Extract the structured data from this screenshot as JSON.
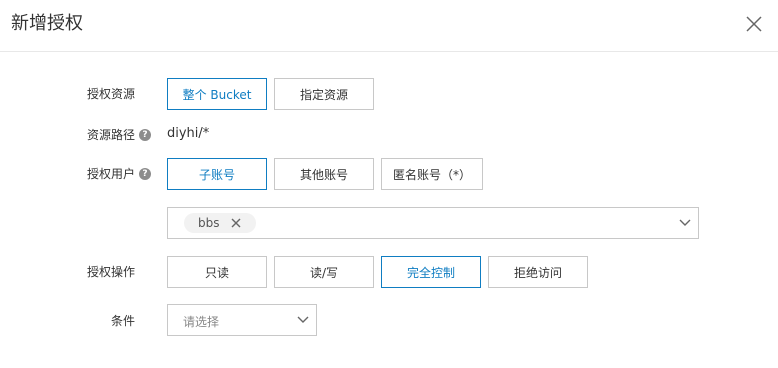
{
  "dialog": {
    "title": "新增授权",
    "close_icon": "close-icon"
  },
  "colors": {
    "accent": "#0f7dc2",
    "border": "#c8c8c8",
    "text": "#333333"
  },
  "resource": {
    "label": "授权资源",
    "options": [
      "整个 Bucket",
      "指定资源"
    ],
    "selected": "整个 Bucket"
  },
  "path": {
    "label": "资源路径",
    "value": "diyhi/*"
  },
  "user": {
    "label": "授权用户",
    "options": [
      "子账号",
      "其他账号",
      "匿名账号（*）"
    ],
    "selected": "子账号",
    "tags": [
      "bbs"
    ]
  },
  "operation": {
    "label": "授权操作",
    "options": [
      "只读",
      "读/写",
      "完全控制",
      "拒绝访问"
    ],
    "selected": "完全控制"
  },
  "condition": {
    "label": "条件",
    "placeholder": "请选择"
  }
}
